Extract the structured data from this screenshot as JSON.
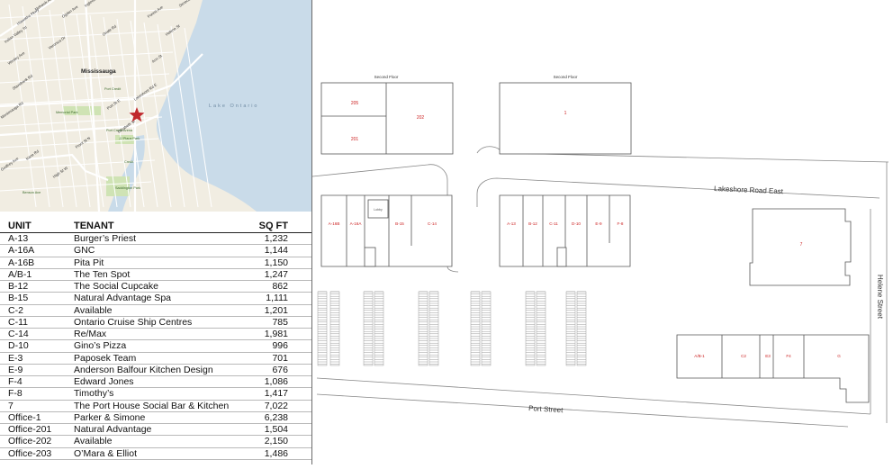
{
  "map": {
    "city_label": "Mississauga",
    "lake_label": "Lake Ontario",
    "streets": [
      "Indian Valley Trl",
      "Hiawatha Pkwy",
      "Mohawk Ave",
      "Ogden Ave",
      "Veronica Dr",
      "Wesley Ave",
      "Stavebank Rd",
      "Mississauga Rd",
      "Front St N",
      "Kane Rd",
      "High St W",
      "Lakeshore Rd E",
      "Port St E",
      "Elizabeth St",
      "Ann St",
      "Helene St",
      "Forest Ave",
      "Seneca Ave",
      "Oriole Rd",
      "Inglewood Dr",
      "Godfrey Ave"
    ],
    "places": [
      "Port Credit",
      "Memorial Park",
      "JJ Plaus Park",
      "Credit",
      "Saddington Park",
      "Benson Ave",
      "Port Credit Arena"
    ]
  },
  "tenant_table": {
    "headers": {
      "unit": "UNIT",
      "tenant": "TENANT",
      "sqft": "SQ FT"
    },
    "rows": [
      {
        "unit": "A-13",
        "tenant": "Burger’s Priest",
        "sqft": "1,232"
      },
      {
        "unit": "A-16A",
        "tenant": "GNC",
        "sqft": "1,144"
      },
      {
        "unit": "A-16B",
        "tenant": "Pita Pit",
        "sqft": "1,150"
      },
      {
        "unit": "A/B-1",
        "tenant": "The Ten Spot",
        "sqft": "1,247"
      },
      {
        "unit": "B-12",
        "tenant": "The Social Cupcake",
        "sqft": "862"
      },
      {
        "unit": "B-15",
        "tenant": "Natural Advantage Spa",
        "sqft": "1,111"
      },
      {
        "unit": "C-2",
        "tenant": "Available",
        "sqft": "1,201"
      },
      {
        "unit": "C-11",
        "tenant": "Ontario Cruise Ship Centres",
        "sqft": "785"
      },
      {
        "unit": "C-14",
        "tenant": "Re/Max",
        "sqft": "1,981"
      },
      {
        "unit": "D-10",
        "tenant": "Gino’s Pizza",
        "sqft": "996"
      },
      {
        "unit": "E-3",
        "tenant": "Paposek Team",
        "sqft": "701"
      },
      {
        "unit": "E-9",
        "tenant": "Anderson Balfour Kitchen Design",
        "sqft": "676"
      },
      {
        "unit": "F-4",
        "tenant": "Edward Jones",
        "sqft": "1,086"
      },
      {
        "unit": "F-8",
        "tenant": "Timothy’s",
        "sqft": "1,417"
      },
      {
        "unit": "7",
        "tenant": "The Port House Social Bar & Kitchen",
        "sqft": "7,022"
      },
      {
        "unit": "Office-1",
        "tenant": "Parker & Simone",
        "sqft": "6,238"
      },
      {
        "unit": "Office-201",
        "tenant": "Natural Advantage",
        "sqft": "1,504"
      },
      {
        "unit": "Office-202",
        "tenant": "Available",
        "sqft": "2,150"
      },
      {
        "unit": "Office-203",
        "tenant": "O’Mara & Elliot",
        "sqft": "1,486"
      }
    ]
  },
  "site_plan": {
    "second_floor_label": "Second Floor",
    "road_lakeshore": "Lakeshore Road East",
    "road_port": "Port Street",
    "road_helene": "Helene Street",
    "lobby_label": "Lobby",
    "office_units": {
      "u205": "205",
      "u202": "202",
      "u201": "201",
      "u1": "1"
    },
    "building_a": [
      "A-16B",
      "A-16A",
      "B-15",
      "C-14"
    ],
    "building_b": [
      "A-13",
      "B-12",
      "C-11",
      "D-10",
      "E-9",
      "F-8"
    ],
    "unit7": "7",
    "building_south": [
      "A/B-1",
      "C2",
      "E3",
      "F4",
      "G"
    ]
  },
  "colors": {
    "unit_label": "#cc2222",
    "water": "#c9dbe9",
    "land": "#f1ede2",
    "road": "#ffffff",
    "park": "#cfe3b4",
    "star": "#c0282d"
  }
}
